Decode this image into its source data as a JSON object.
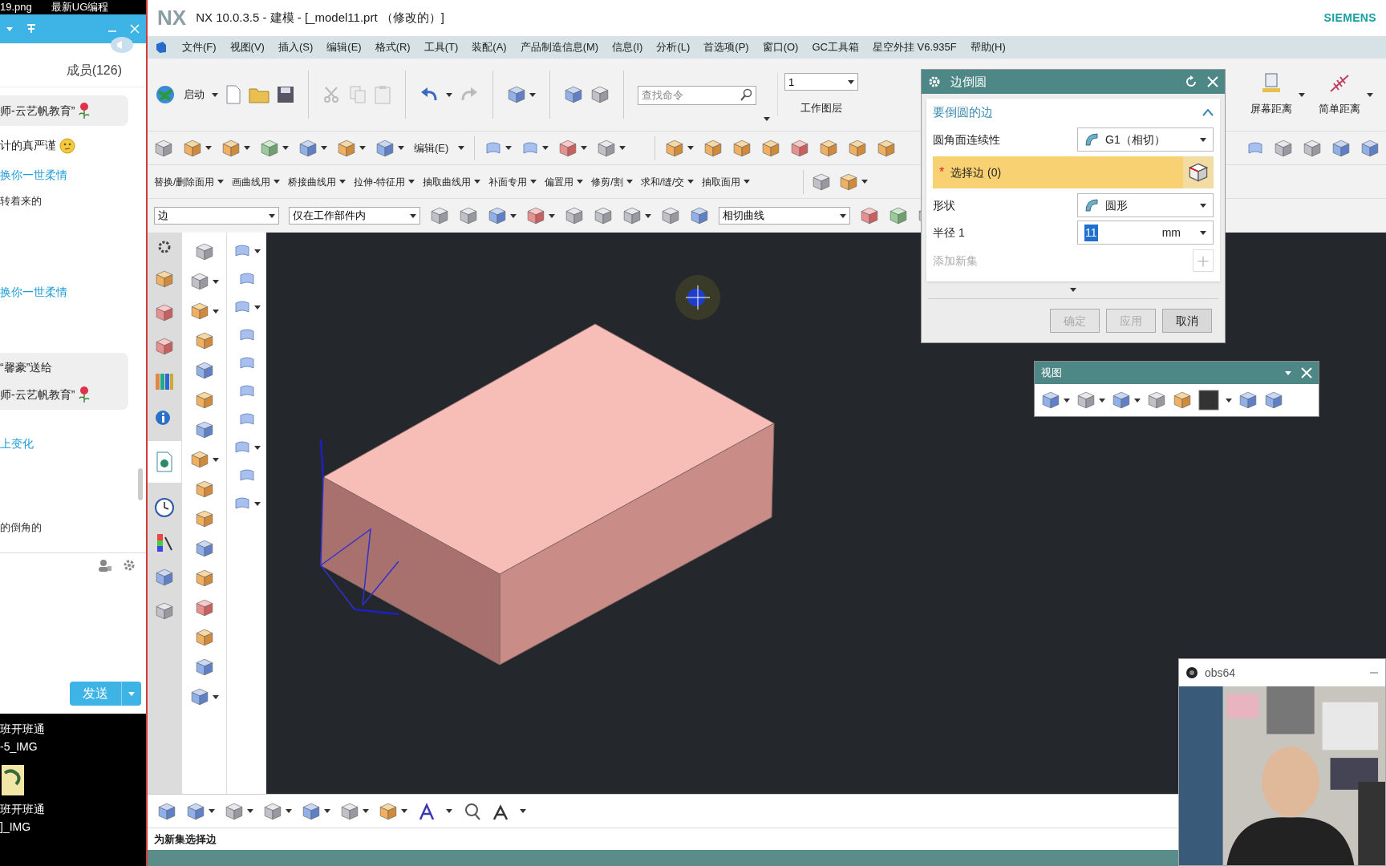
{
  "taskbar_titles": [
    "19.png",
    "最新UG编程"
  ],
  "chat": {
    "members": "成员(126)",
    "messages": [
      {
        "kind": "bubble",
        "lines": [
          "师-云艺帆教育”"
        ]
      },
      {
        "kind": "emote",
        "lines": [
          "计的真严谨"
        ]
      },
      {
        "kind": "link",
        "lines": [
          "换你一世柔情"
        ]
      },
      {
        "kind": "text",
        "lines": [
          "转着来的"
        ]
      },
      {
        "kind": "link",
        "lines": [
          "换你一世柔情"
        ]
      },
      {
        "kind": "bubble",
        "lines": [
          "“馨豪”送给",
          "师-云艺帆教育”"
        ]
      },
      {
        "kind": "link",
        "lines": [
          "上变化"
        ]
      },
      {
        "kind": "text",
        "lines": [
          "的倒角的"
        ]
      }
    ],
    "send_button": "发送"
  },
  "desktop_items": [
    {
      "lines": [
        "班开班通",
        "-5_IMG"
      ],
      "has_icon": false
    },
    {
      "lines": [
        "班开班通",
        "]_IMG"
      ],
      "has_icon": true
    }
  ],
  "window": {
    "logo": "NX",
    "title": "NX 10.0.3.5 - 建模 - [_model11.prt （修改的）]",
    "brand": "SIEMENS"
  },
  "menu": [
    "文件(F)",
    "视图(V)",
    "插入(S)",
    "编辑(E)",
    "格式(R)",
    "工具(T)",
    "装配(A)",
    "产品制造信息(M)",
    "信息(I)",
    "分析(L)",
    "首选项(P)",
    "窗口(O)",
    "GC工具箱",
    "星空外挂 V6.935F",
    "帮助(H)"
  ],
  "toolbar": {
    "start_label": "启动",
    "search": {
      "placeholder": "查找命令"
    },
    "layer": {
      "value": "1",
      "label": "工作图层"
    },
    "edit_menu": "编辑(E)",
    "command_menus": [
      "替换/删除面用",
      "画曲线用",
      "桥接曲线用",
      "拉伸-特征用",
      "抽取曲线用",
      "补面专用",
      "偏置用",
      "修剪/割",
      "求和/缝/交",
      "抽取面用"
    ],
    "selection": {
      "filter": "边",
      "scope": "仅在工作部件内",
      "rule": "相切曲线"
    },
    "measure": [
      "屏幕距离",
      "简单距离"
    ]
  },
  "dialog": {
    "title": "边倒圆",
    "section": {
      "title": "要倒圆的边",
      "expanded": true
    },
    "rows": [
      {
        "kind": "dropdown",
        "label": "圆角面连续性",
        "value": "G1（相切）"
      },
      {
        "kind": "select",
        "marker": "*",
        "label": "选择边 (0)",
        "active": true
      },
      {
        "kind": "dropdown",
        "label": "形状",
        "value": "圆形"
      },
      {
        "kind": "number",
        "label": "半径 1",
        "value": "11",
        "unit": "mm"
      },
      {
        "kind": "action",
        "label": "添加新集",
        "disabled": true
      }
    ],
    "buttons": [
      {
        "label": "确定",
        "disabled": true
      },
      {
        "label": "应用",
        "disabled": true
      },
      {
        "label": "取消",
        "disabled": false
      }
    ]
  },
  "view_toolbar": {
    "title": "视图"
  },
  "status_bar": "为新集选择边",
  "obs": {
    "title": "obs64"
  }
}
